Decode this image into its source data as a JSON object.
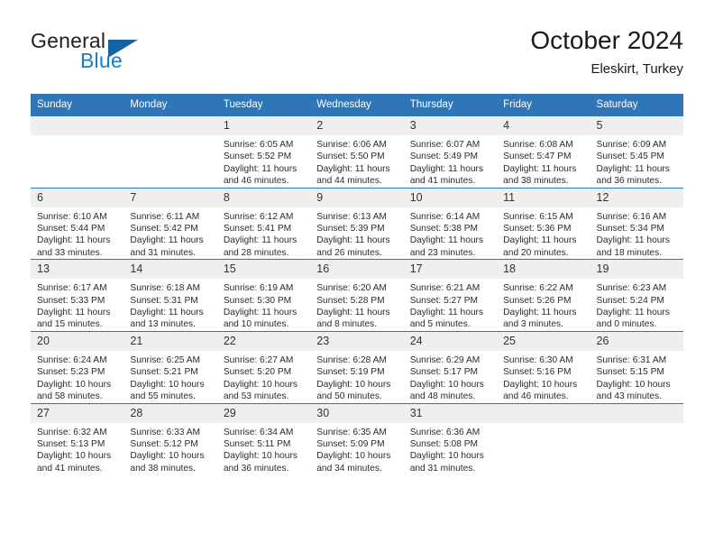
{
  "brand": {
    "name_part1": "General",
    "name_part2": "Blue",
    "triangle_icon": "triangle-icon"
  },
  "header": {
    "title": "October 2024",
    "subtitle": "Eleskirt, Turkey"
  },
  "colors": {
    "header_blue": "#2f76b8",
    "daynum_band": "#efefef",
    "brand_blue": "#1a7cc6",
    "brand_triangle": "#1464a5",
    "text": "#2b2b2b"
  },
  "calendar": {
    "weekday_headers": [
      "Sunday",
      "Monday",
      "Tuesday",
      "Wednesday",
      "Thursday",
      "Friday",
      "Saturday"
    ],
    "weeks": [
      [
        {
          "day": "",
          "sunrise": "",
          "sunset": "",
          "daylight1": "",
          "daylight2": "",
          "empty": true
        },
        {
          "day": "",
          "sunrise": "",
          "sunset": "",
          "daylight1": "",
          "daylight2": "",
          "empty": true
        },
        {
          "day": "1",
          "sunrise": "Sunrise: 6:05 AM",
          "sunset": "Sunset: 5:52 PM",
          "daylight1": "Daylight: 11 hours",
          "daylight2": "and 46 minutes."
        },
        {
          "day": "2",
          "sunrise": "Sunrise: 6:06 AM",
          "sunset": "Sunset: 5:50 PM",
          "daylight1": "Daylight: 11 hours",
          "daylight2": "and 44 minutes."
        },
        {
          "day": "3",
          "sunrise": "Sunrise: 6:07 AM",
          "sunset": "Sunset: 5:49 PM",
          "daylight1": "Daylight: 11 hours",
          "daylight2": "and 41 minutes."
        },
        {
          "day": "4",
          "sunrise": "Sunrise: 6:08 AM",
          "sunset": "Sunset: 5:47 PM",
          "daylight1": "Daylight: 11 hours",
          "daylight2": "and 38 minutes."
        },
        {
          "day": "5",
          "sunrise": "Sunrise: 6:09 AM",
          "sunset": "Sunset: 5:45 PM",
          "daylight1": "Daylight: 11 hours",
          "daylight2": "and 36 minutes."
        }
      ],
      [
        {
          "day": "6",
          "sunrise": "Sunrise: 6:10 AM",
          "sunset": "Sunset: 5:44 PM",
          "daylight1": "Daylight: 11 hours",
          "daylight2": "and 33 minutes."
        },
        {
          "day": "7",
          "sunrise": "Sunrise: 6:11 AM",
          "sunset": "Sunset: 5:42 PM",
          "daylight1": "Daylight: 11 hours",
          "daylight2": "and 31 minutes."
        },
        {
          "day": "8",
          "sunrise": "Sunrise: 6:12 AM",
          "sunset": "Sunset: 5:41 PM",
          "daylight1": "Daylight: 11 hours",
          "daylight2": "and 28 minutes."
        },
        {
          "day": "9",
          "sunrise": "Sunrise: 6:13 AM",
          "sunset": "Sunset: 5:39 PM",
          "daylight1": "Daylight: 11 hours",
          "daylight2": "and 26 minutes."
        },
        {
          "day": "10",
          "sunrise": "Sunrise: 6:14 AM",
          "sunset": "Sunset: 5:38 PM",
          "daylight1": "Daylight: 11 hours",
          "daylight2": "and 23 minutes."
        },
        {
          "day": "11",
          "sunrise": "Sunrise: 6:15 AM",
          "sunset": "Sunset: 5:36 PM",
          "daylight1": "Daylight: 11 hours",
          "daylight2": "and 20 minutes."
        },
        {
          "day": "12",
          "sunrise": "Sunrise: 6:16 AM",
          "sunset": "Sunset: 5:34 PM",
          "daylight1": "Daylight: 11 hours",
          "daylight2": "and 18 minutes."
        }
      ],
      [
        {
          "day": "13",
          "sunrise": "Sunrise: 6:17 AM",
          "sunset": "Sunset: 5:33 PM",
          "daylight1": "Daylight: 11 hours",
          "daylight2": "and 15 minutes."
        },
        {
          "day": "14",
          "sunrise": "Sunrise: 6:18 AM",
          "sunset": "Sunset: 5:31 PM",
          "daylight1": "Daylight: 11 hours",
          "daylight2": "and 13 minutes."
        },
        {
          "day": "15",
          "sunrise": "Sunrise: 6:19 AM",
          "sunset": "Sunset: 5:30 PM",
          "daylight1": "Daylight: 11 hours",
          "daylight2": "and 10 minutes."
        },
        {
          "day": "16",
          "sunrise": "Sunrise: 6:20 AM",
          "sunset": "Sunset: 5:28 PM",
          "daylight1": "Daylight: 11 hours",
          "daylight2": "and 8 minutes."
        },
        {
          "day": "17",
          "sunrise": "Sunrise: 6:21 AM",
          "sunset": "Sunset: 5:27 PM",
          "daylight1": "Daylight: 11 hours",
          "daylight2": "and 5 minutes."
        },
        {
          "day": "18",
          "sunrise": "Sunrise: 6:22 AM",
          "sunset": "Sunset: 5:26 PM",
          "daylight1": "Daylight: 11 hours",
          "daylight2": "and 3 minutes."
        },
        {
          "day": "19",
          "sunrise": "Sunrise: 6:23 AM",
          "sunset": "Sunset: 5:24 PM",
          "daylight1": "Daylight: 11 hours",
          "daylight2": "and 0 minutes."
        }
      ],
      [
        {
          "day": "20",
          "sunrise": "Sunrise: 6:24 AM",
          "sunset": "Sunset: 5:23 PM",
          "daylight1": "Daylight: 10 hours",
          "daylight2": "and 58 minutes."
        },
        {
          "day": "21",
          "sunrise": "Sunrise: 6:25 AM",
          "sunset": "Sunset: 5:21 PM",
          "daylight1": "Daylight: 10 hours",
          "daylight2": "and 55 minutes."
        },
        {
          "day": "22",
          "sunrise": "Sunrise: 6:27 AM",
          "sunset": "Sunset: 5:20 PM",
          "daylight1": "Daylight: 10 hours",
          "daylight2": "and 53 minutes."
        },
        {
          "day": "23",
          "sunrise": "Sunrise: 6:28 AM",
          "sunset": "Sunset: 5:19 PM",
          "daylight1": "Daylight: 10 hours",
          "daylight2": "and 50 minutes."
        },
        {
          "day": "24",
          "sunrise": "Sunrise: 6:29 AM",
          "sunset": "Sunset: 5:17 PM",
          "daylight1": "Daylight: 10 hours",
          "daylight2": "and 48 minutes."
        },
        {
          "day": "25",
          "sunrise": "Sunrise: 6:30 AM",
          "sunset": "Sunset: 5:16 PM",
          "daylight1": "Daylight: 10 hours",
          "daylight2": "and 46 minutes."
        },
        {
          "day": "26",
          "sunrise": "Sunrise: 6:31 AM",
          "sunset": "Sunset: 5:15 PM",
          "daylight1": "Daylight: 10 hours",
          "daylight2": "and 43 minutes."
        }
      ],
      [
        {
          "day": "27",
          "sunrise": "Sunrise: 6:32 AM",
          "sunset": "Sunset: 5:13 PM",
          "daylight1": "Daylight: 10 hours",
          "daylight2": "and 41 minutes."
        },
        {
          "day": "28",
          "sunrise": "Sunrise: 6:33 AM",
          "sunset": "Sunset: 5:12 PM",
          "daylight1": "Daylight: 10 hours",
          "daylight2": "and 38 minutes."
        },
        {
          "day": "29",
          "sunrise": "Sunrise: 6:34 AM",
          "sunset": "Sunset: 5:11 PM",
          "daylight1": "Daylight: 10 hours",
          "daylight2": "and 36 minutes."
        },
        {
          "day": "30",
          "sunrise": "Sunrise: 6:35 AM",
          "sunset": "Sunset: 5:09 PM",
          "daylight1": "Daylight: 10 hours",
          "daylight2": "and 34 minutes."
        },
        {
          "day": "31",
          "sunrise": "Sunrise: 6:36 AM",
          "sunset": "Sunset: 5:08 PM",
          "daylight1": "Daylight: 10 hours",
          "daylight2": "and 31 minutes."
        },
        {
          "day": "",
          "sunrise": "",
          "sunset": "",
          "daylight1": "",
          "daylight2": "",
          "empty": true
        },
        {
          "day": "",
          "sunrise": "",
          "sunset": "",
          "daylight1": "",
          "daylight2": "",
          "empty": true
        }
      ]
    ]
  }
}
